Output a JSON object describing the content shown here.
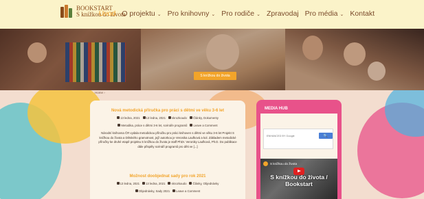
{
  "logo": {
    "title": "BOOKSTART",
    "subtitle": "S knížkou do života"
  },
  "nav": [
    {
      "label": "Úvod",
      "active": true,
      "dropdown": false
    },
    {
      "label": "O projektu",
      "active": false,
      "dropdown": true
    },
    {
      "label": "Pro knihovny",
      "active": false,
      "dropdown": true
    },
    {
      "label": "Pro rodiče",
      "active": false,
      "dropdown": true
    },
    {
      "label": "Zpravodaj",
      "active": false,
      "dropdown": false
    },
    {
      "label": "Pro média",
      "active": false,
      "dropdown": true
    },
    {
      "label": "Kontakt",
      "active": false,
      "dropdown": false
    }
  ],
  "hero": {
    "button_label": "S knížkou do života"
  },
  "breadcrumb": "Home",
  "posts": [
    {
      "title": "Nová metodická příručka pro práci s dětmi ve věku 3-6 let",
      "date": "13 ledna, 2021",
      "date2": "13 ledna, 2021",
      "author": "skrozkoudo",
      "categories": "Články, Dokumenty",
      "tags": "Metodika, práce s dětmi 3-6 let, scénáře programů",
      "comment": "Leave a Comment",
      "excerpt": "Národní knihovna ČR vydala metodickou příručku pro práci knihoven s dětmi ve věku 3-6 let Projekt S knížkou do života a Dětského gramotnost, jejž autorkou je Veronika Laufková a kol. Základem metodické příručky ke druhé etapě projektu S knížkou do života je staff PhDr. Veroniky Laufková, Ph.D. Do publikace dále přispěly scénáři programů pro děti ve [...]"
    },
    {
      "title": "Možnost doobjednat sady pro rok 2021",
      "date": "13 ledna, 2021",
      "date2": "13 ledna, 2021",
      "author": "skrozkoudo",
      "categories": "Články, Objednávky",
      "tags": "Objednávky, Sady 2021",
      "comment": "Leave a Comment"
    }
  ],
  "sidebar": {
    "title": "MEDIA HUB",
    "search_placeholder": "ENHANCED BY Google",
    "search_button": "🔍",
    "video_channel": "S knížkou do života",
    "video_title": "S knížkou do života / Bookstart"
  },
  "colors": {
    "accent": "#f2a42a",
    "pink": "#e8528a",
    "header_bg": "#fbf3c9",
    "page_bg": "#f3ddcf"
  }
}
